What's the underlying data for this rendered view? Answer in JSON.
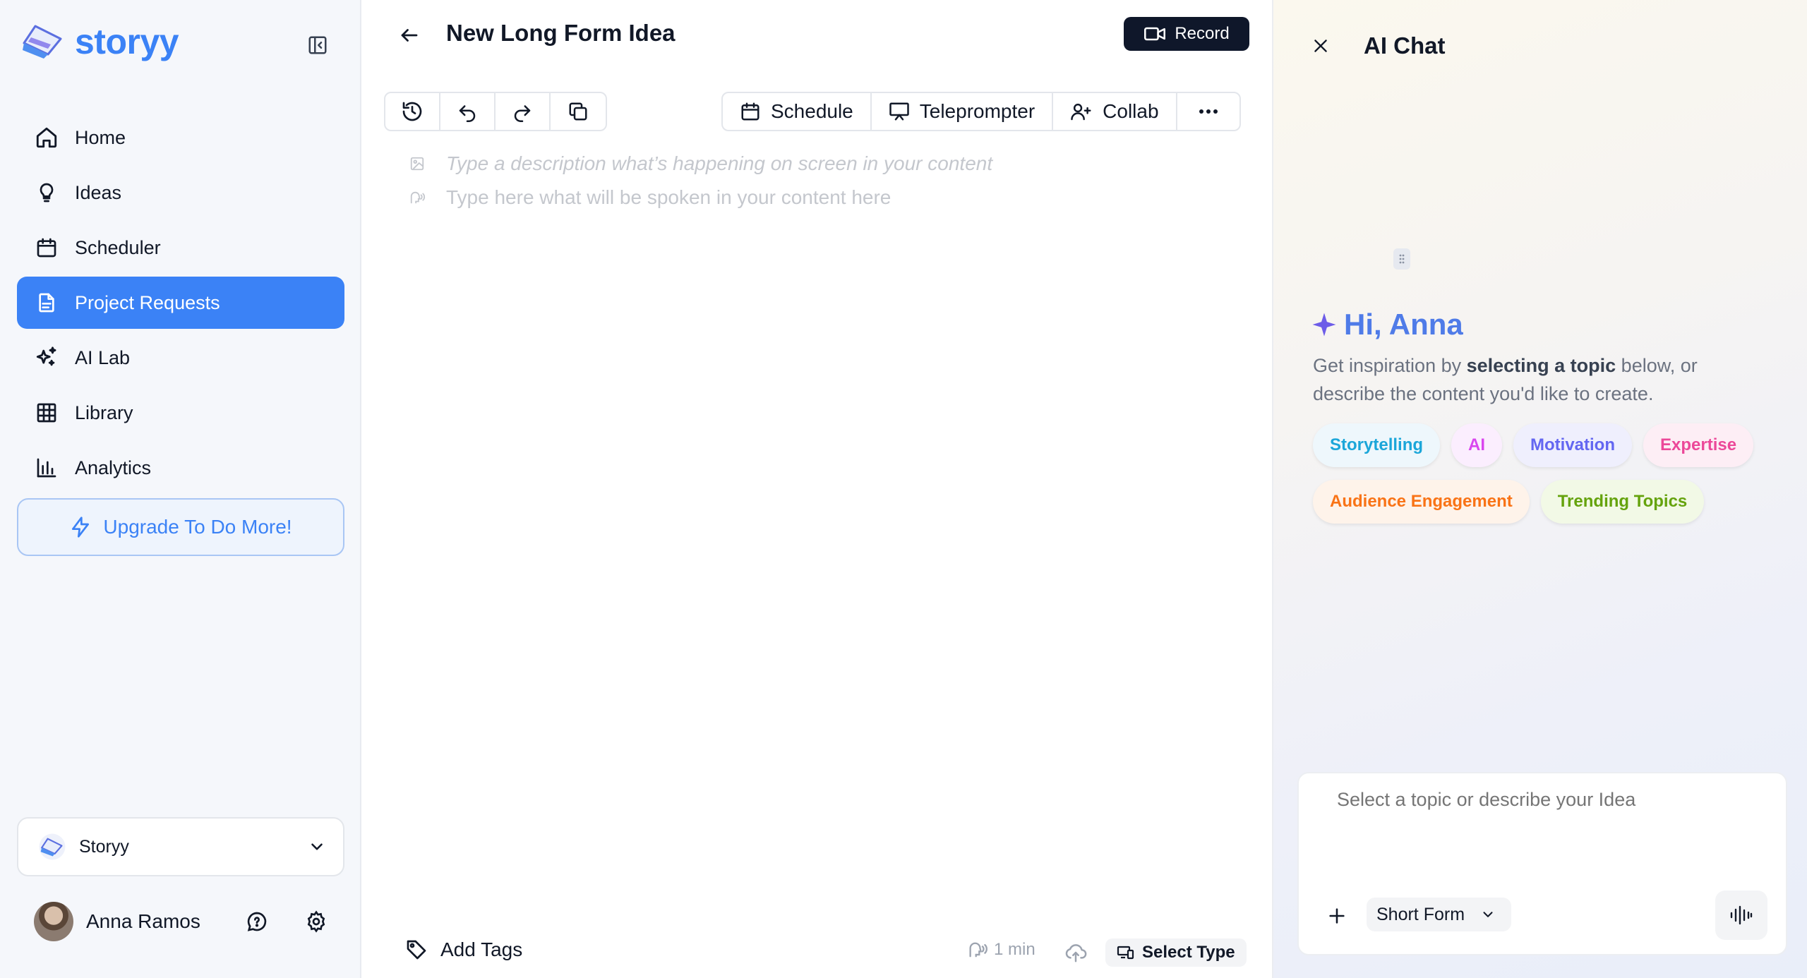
{
  "brand": {
    "name": "storyy",
    "accent": "#3b82f6"
  },
  "sidebar": {
    "items": [
      {
        "label": "Home",
        "icon": "home-icon",
        "active": false
      },
      {
        "label": "Ideas",
        "icon": "lightbulb-icon",
        "active": false
      },
      {
        "label": "Scheduler",
        "icon": "calendar-icon",
        "active": false
      },
      {
        "label": "Project Requests",
        "icon": "document-icon",
        "active": true
      },
      {
        "label": "AI Lab",
        "icon": "sparkles-icon",
        "active": false
      },
      {
        "label": "Library",
        "icon": "grid-icon",
        "active": false
      },
      {
        "label": "Analytics",
        "icon": "bar-chart-icon",
        "active": false
      }
    ],
    "upgrade_label": "Upgrade To Do More!",
    "workspace": "Storyy",
    "user_name": "Anna Ramos"
  },
  "editor": {
    "title": "New Long Form Idea",
    "record_label": "Record",
    "toolbar": {
      "schedule": "Schedule",
      "teleprompter": "Teleprompter",
      "collab": "Collab"
    },
    "description_placeholder": "Type a description what’s happening on screen in your content",
    "spoken_placeholder": "Type here what will be spoken in your content here",
    "footer": {
      "add_tags": "Add Tags",
      "duration": "1 min",
      "select_type": "Select Type"
    }
  },
  "chat": {
    "title": "AI Chat",
    "greeting": "Hi, Anna",
    "intro_pre": "Get inspiration by ",
    "intro_bold": "selecting a topic",
    "intro_post": " below, or describe the content you'd like to create.",
    "chips": [
      {
        "label": "Storytelling",
        "color": "#1ba6d9",
        "bg": "#eef7fc"
      },
      {
        "label": "AI",
        "color": "#d946ef",
        "bg": "#fbeefe"
      },
      {
        "label": "Motivation",
        "color": "#6366f1",
        "bg": "#efeffd"
      },
      {
        "label": "Expertise",
        "color": "#ec4899",
        "bg": "#fdeef5"
      },
      {
        "label": "Audience Engagement",
        "color": "#f97316",
        "bg": "#fef3ea"
      },
      {
        "label": "Trending Topics",
        "color": "#65a30d",
        "bg": "#f2f9e6"
      }
    ],
    "input_placeholder": "Select a topic or describe your Idea",
    "format": "Short Form"
  }
}
